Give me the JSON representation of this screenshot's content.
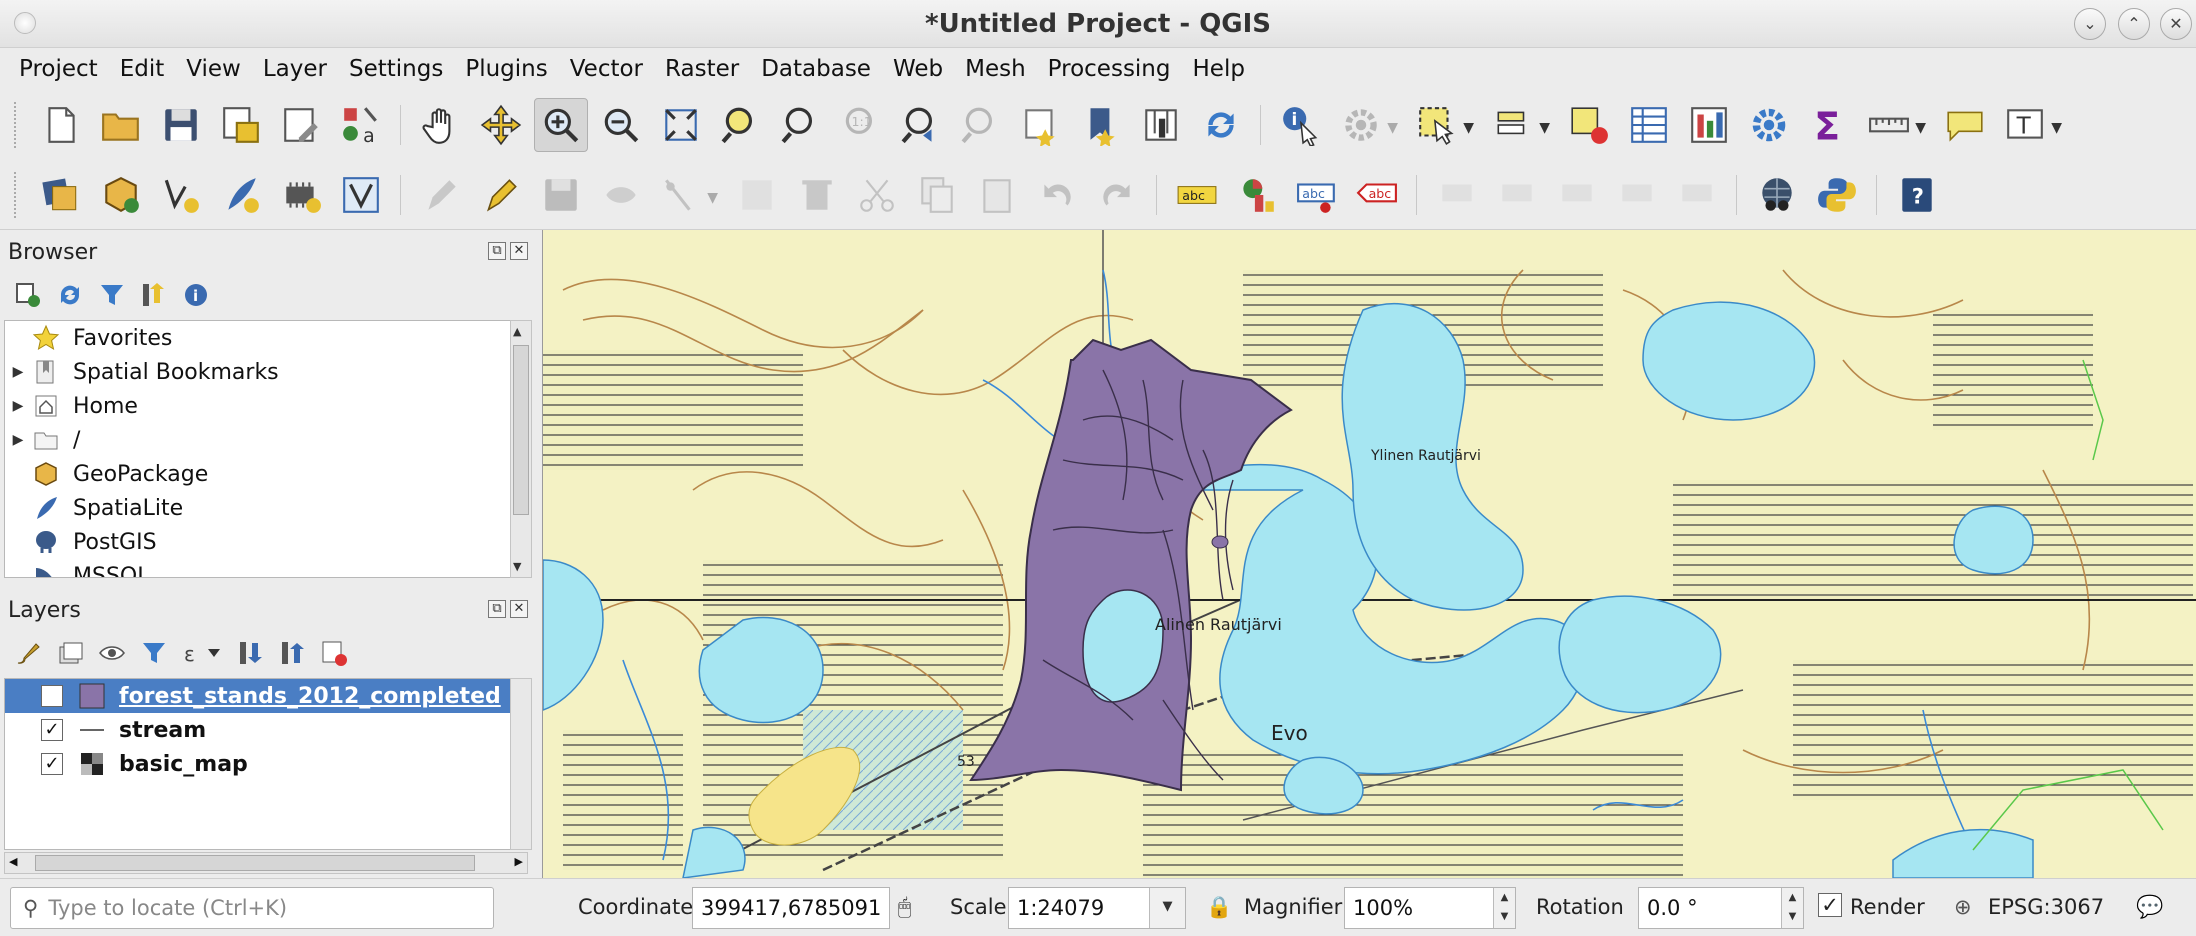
{
  "window": {
    "title": "*Untitled Project - QGIS"
  },
  "menu": [
    "Project",
    "Edit",
    "View",
    "Layer",
    "Settings",
    "Plugins",
    "Vector",
    "Raster",
    "Database",
    "Web",
    "Mesh",
    "Processing",
    "Help"
  ],
  "browser": {
    "title": "Browser",
    "items": [
      {
        "label": "Favorites",
        "icon": "star-icon",
        "expandable": false
      },
      {
        "label": "Spatial Bookmarks",
        "icon": "bookmark-icon",
        "expandable": true
      },
      {
        "label": "Home",
        "icon": "home-icon",
        "expandable": true
      },
      {
        "label": "/",
        "icon": "folder-icon",
        "expandable": true
      },
      {
        "label": "GeoPackage",
        "icon": "geopackage-icon",
        "expandable": false
      },
      {
        "label": "SpatiaLite",
        "icon": "spatialite-icon",
        "expandable": false
      },
      {
        "label": "PostGIS",
        "icon": "postgis-icon",
        "expandable": false
      },
      {
        "label": "MSSQL",
        "icon": "mssql-icon",
        "expandable": false
      }
    ]
  },
  "layers": {
    "title": "Layers",
    "items": [
      {
        "label": "forest_stands_2012_completed",
        "checked": "✓",
        "symbol": "polygon-fill",
        "selected": true
      },
      {
        "label": "stream",
        "checked": "✓",
        "symbol": "line",
        "selected": false
      },
      {
        "label": "basic_map",
        "checked": "✓",
        "symbol": "raster",
        "selected": false
      }
    ]
  },
  "map_labels": {
    "lake_1": "Alinen Rautjärvi",
    "lake_2": "Ylinen Rautjärvi",
    "town": "Evo",
    "road": "53"
  },
  "status": {
    "locator_placeholder": "Type to locate (Ctrl+K)",
    "coordinate_label": "Coordinate",
    "coordinate_value": "399417,6785091",
    "scale_label": "Scale",
    "scale_value": "1:24079",
    "magnifier_label": "Magnifier",
    "magnifier_value": "100%",
    "rotation_label": "Rotation",
    "rotation_value": "0.0 °",
    "render_label": "Render",
    "render_checked": "✓",
    "crs": "EPSG:3067"
  },
  "colors": {
    "forest_stands_fill": "#8a74a8",
    "water": "#a6e6f2",
    "map_background": "#f4f2c4",
    "selection": "#4a7ec4"
  }
}
